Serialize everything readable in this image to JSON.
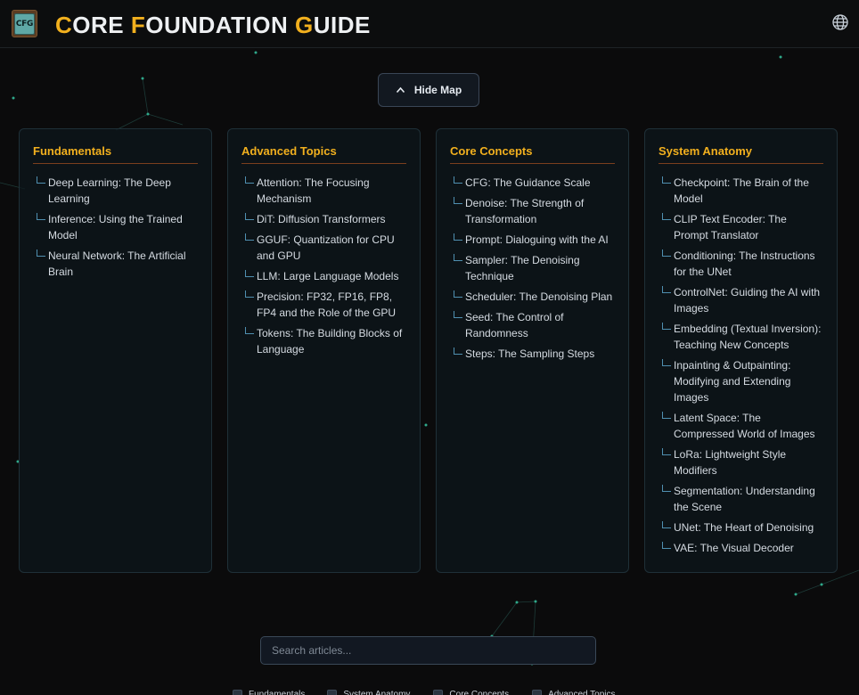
{
  "header": {
    "logo_text": "CFG",
    "title_parts": [
      {
        "cap": "C",
        "rest": "ORE "
      },
      {
        "cap": "F",
        "rest": "OUNDATION "
      },
      {
        "cap": "G",
        "rest": "UIDE"
      }
    ],
    "globe_icon": "globe-icon"
  },
  "map_toggle": {
    "label": "Hide Map",
    "icon": "chevron-up-icon"
  },
  "categories": [
    {
      "title": "Fundamentals",
      "items": [
        "Deep Learning: The Deep Learning",
        "Inference: Using the Trained Model",
        "Neural Network: The Artificial Brain"
      ]
    },
    {
      "title": "Advanced Topics",
      "items": [
        "Attention: The Focusing Mechanism",
        "DiT: Diffusion Transformers",
        "GGUF: Quantization for CPU and GPU",
        "LLM: Large Language Models",
        "Precision: FP32, FP16, FP8, FP4 and the Role of the GPU",
        "Tokens: The Building Blocks of Language"
      ]
    },
    {
      "title": "Core Concepts",
      "items": [
        "CFG: The Guidance Scale",
        "Denoise: The Strength of Transformation",
        "Prompt: Dialoguing with the AI",
        "Sampler: The Denoising Technique",
        "Scheduler: The Denoising Plan",
        "Seed: The Control of Randomness",
        "Steps: The Sampling Steps"
      ]
    },
    {
      "title": "System Anatomy",
      "items": [
        "Checkpoint: The Brain of the Model",
        "CLIP Text Encoder: The Prompt Translator",
        "Conditioning: The Instructions for the UNet",
        "ControlNet: Guiding the AI with Images",
        "Embedding (Textual Inversion): Teaching New Concepts",
        "Inpainting & Outpainting: Modifying and Extending Images",
        "Latent Space: The Compressed World of Images",
        "LoRa: Lightweight Style Modifiers",
        "Segmentation: Understanding the Scene",
        "UNet: The Heart of Denoising",
        "VAE: The Visual Decoder"
      ]
    }
  ],
  "search": {
    "placeholder": "Search articles..."
  },
  "filters": [
    "Fundamentals",
    "System Anatomy",
    "Core Concepts",
    "Advanced Topics"
  ],
  "colors": {
    "accent": "#f2b01e",
    "background": "#0b0b0c",
    "card_border": "#1f3038",
    "divider": "#7a3e1e",
    "tree_line": "#4f8fb0",
    "network_node": "#2fa88a"
  }
}
